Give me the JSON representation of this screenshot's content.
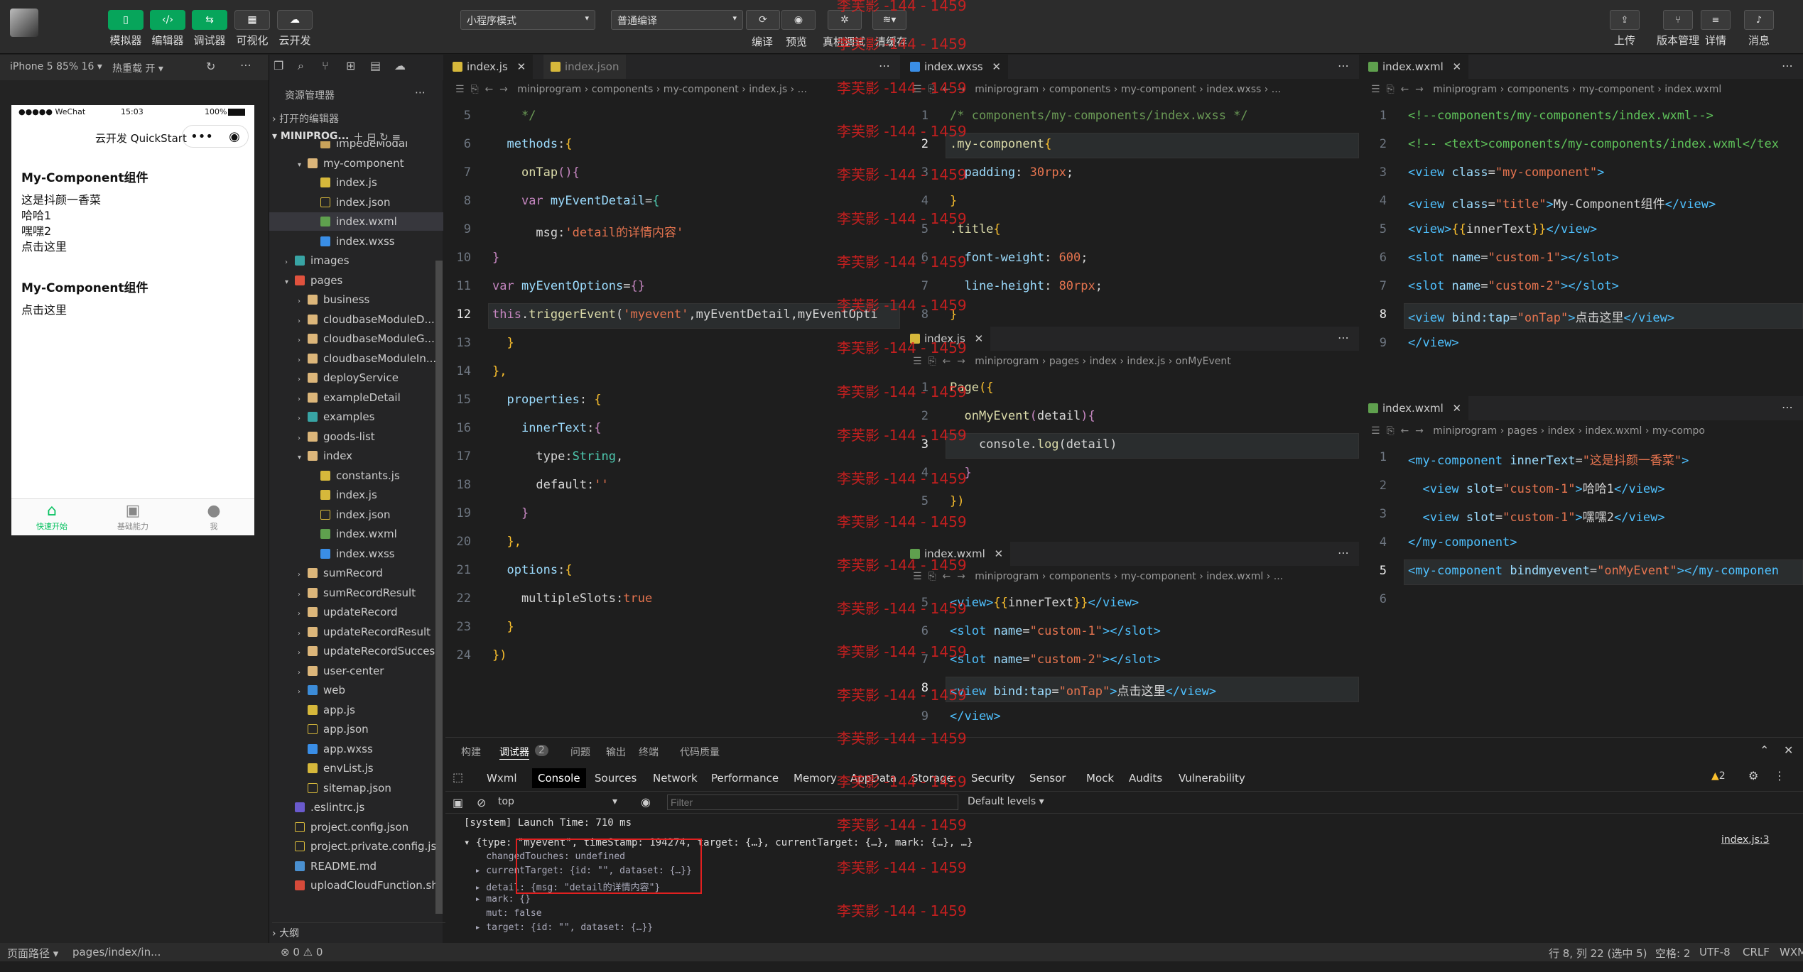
{
  "toolbar": {
    "buttons": [
      "模拟器",
      "编辑器",
      "调试器",
      "可视化",
      "云开发"
    ],
    "mode_select": "小程序模式",
    "compile_select": "普通编译",
    "center_labels": [
      "编译",
      "预览",
      "真机调试",
      "清缓存"
    ],
    "right_labels": [
      "上传",
      "版本管理",
      "详情",
      "消息"
    ]
  },
  "simulator": {
    "device": "iPhone 5 85% 16 ▾",
    "hot_reload": "热重载 开 ▾",
    "status_carrier": "●●●●● WeChat",
    "status_time": "15:03",
    "status_battery": "100%",
    "nav_title": "云开发 QuickStart",
    "content": [
      {
        "heading": "My-Component组件",
        "lines": [
          "这是抖颜一香菜",
          "哈哈1",
          "嘿嘿2",
          "点击这里"
        ]
      },
      {
        "heading": "My-Component组件",
        "lines": [
          "点击这里"
        ]
      }
    ],
    "tabbar": [
      {
        "label": "快速开始",
        "icon": "home-icon"
      },
      {
        "label": "基础能力",
        "icon": "terminal-icon"
      },
      {
        "label": "我",
        "icon": "user-icon"
      }
    ]
  },
  "explorer": {
    "title": "资源管理器",
    "open_editors": "打开的编辑器",
    "project": "MINIPROG...",
    "items": [
      {
        "name": "impedeModal",
        "type": "dir",
        "indent": 3
      },
      {
        "name": "my-component",
        "type": "folder",
        "indent": 2,
        "open": true
      },
      {
        "name": "index.js",
        "type": "js",
        "indent": 3
      },
      {
        "name": "index.json",
        "type": "json",
        "indent": 3
      },
      {
        "name": "index.wxml",
        "type": "wxml",
        "indent": 3,
        "selected": true
      },
      {
        "name": "index.wxss",
        "type": "wxss",
        "indent": 3
      },
      {
        "name": "images",
        "type": "fteal",
        "indent": 1,
        "closed": true
      },
      {
        "name": "pages",
        "type": "fred",
        "indent": 1,
        "open": true
      },
      {
        "name": "business",
        "type": "folder",
        "indent": 2,
        "closed": true
      },
      {
        "name": "cloudbaseModuleD...",
        "type": "folder",
        "indent": 2,
        "closed": true
      },
      {
        "name": "cloudbaseModuleG...",
        "type": "folder",
        "indent": 2,
        "closed": true
      },
      {
        "name": "cloudbaseModuleIn...",
        "type": "folder",
        "indent": 2,
        "closed": true
      },
      {
        "name": "deployService",
        "type": "folder",
        "indent": 2,
        "closed": true
      },
      {
        "name": "exampleDetail",
        "type": "folder",
        "indent": 2,
        "closed": true
      },
      {
        "name": "examples",
        "type": "fteal",
        "indent": 2,
        "closed": true
      },
      {
        "name": "goods-list",
        "type": "folder",
        "indent": 2,
        "closed": true
      },
      {
        "name": "index",
        "type": "folder",
        "indent": 2,
        "open": true
      },
      {
        "name": "constants.js",
        "type": "js",
        "indent": 3
      },
      {
        "name": "index.js",
        "type": "js",
        "indent": 3
      },
      {
        "name": "index.json",
        "type": "json",
        "indent": 3
      },
      {
        "name": "index.wxml",
        "type": "wxml",
        "indent": 3
      },
      {
        "name": "index.wxss",
        "type": "wxss",
        "indent": 3
      },
      {
        "name": "sumRecord",
        "type": "folder",
        "indent": 2,
        "closed": true
      },
      {
        "name": "sumRecordResult",
        "type": "folder",
        "indent": 2,
        "closed": true
      },
      {
        "name": "updateRecord",
        "type": "folder",
        "indent": 2,
        "closed": true
      },
      {
        "name": "updateRecordResult",
        "type": "folder",
        "indent": 2,
        "closed": true
      },
      {
        "name": "updateRecordSuccess",
        "type": "folder",
        "indent": 2,
        "closed": true
      },
      {
        "name": "user-center",
        "type": "folder",
        "indent": 2,
        "closed": true
      },
      {
        "name": "web",
        "type": "fblue",
        "indent": 2,
        "closed": true
      },
      {
        "name": "app.js",
        "type": "js",
        "indent": 2
      },
      {
        "name": "app.json",
        "type": "json",
        "indent": 2
      },
      {
        "name": "app.wxss",
        "type": "wxss",
        "indent": 2
      },
      {
        "name": "envList.js",
        "type": "js",
        "indent": 2
      },
      {
        "name": "sitemap.json",
        "type": "json",
        "indent": 2
      },
      {
        "name": ".eslintrc.js",
        "type": "esl",
        "indent": 1
      },
      {
        "name": "project.config.json",
        "type": "json",
        "indent": 1
      },
      {
        "name": "project.private.config.js...",
        "type": "json",
        "indent": 1
      },
      {
        "name": "README.md",
        "type": "md",
        "indent": 1
      },
      {
        "name": "uploadCloudFunction.sh",
        "type": "sh",
        "indent": 1
      }
    ],
    "outline": "大纲"
  },
  "editor1": {
    "tabs": [
      "index.js",
      "index.json"
    ],
    "crumb": "miniprogram  ›  components  ›  my-component  ›  index.js  ›  ...",
    "lines": [
      {
        "n": "5",
        "html": "    <span class='c'>*/</span>"
      },
      {
        "n": "6",
        "html": "  <span class='v'>methods</span>:<span class='p'>{</span>"
      },
      {
        "n": "7",
        "html": "    <span class='f'>onTap</span><span class='k'>(){</span>"
      },
      {
        "n": "8",
        "html": "    <span class='k'>var</span> <span class='v'>myEventDetail</span>=<span class='t'>{</span>"
      },
      {
        "n": "9",
        "html": "      msg:<span class='s'>'detail的详情内容'</span>"
      },
      {
        "n": "10",
        "html": "<span class='k'>}</span>"
      },
      {
        "n": "11",
        "html": "<span class='k'>var</span> <span class='v'>myEventOptions</span>=<span class='k'>{}</span>"
      },
      {
        "n": "12",
        "html": "<span class='k'>this</span>.<span class='f'>triggerEvent</span>(<span class='s'>'myevent'</span>,myEventDetail,myEventOpti",
        "cur": true
      },
      {
        "n": "13",
        "html": "  <span class='p'>}</span>"
      },
      {
        "n": "14",
        "html": "<span class='p'>},</span>"
      },
      {
        "n": "15",
        "html": "  <span class='v'>properties</span>: <span class='p'>{</span>"
      },
      {
        "n": "16",
        "html": "    <span class='v'>innerText</span>:<span class='k'>{</span>"
      },
      {
        "n": "17",
        "html": "      type:<span class='t'>String</span>,"
      },
      {
        "n": "18",
        "html": "      default:<span class='s'>''</span>"
      },
      {
        "n": "19",
        "html": "    <span class='k'>}</span>"
      },
      {
        "n": "20",
        "html": "  <span class='p'>},</span>"
      },
      {
        "n": "21",
        "html": "  <span class='v'>options</span>:<span class='p'>{</span>"
      },
      {
        "n": "22",
        "html": "    multipleSlots:<span class='n'>true</span>"
      },
      {
        "n": "23",
        "html": "  <span class='p'>}</span>"
      },
      {
        "n": "24",
        "html": "<span class='p'>})</span>"
      }
    ]
  },
  "editor2": {
    "tab": "index.wxss",
    "crumb": "miniprogram  ›  components  ›  my-component  ›  index.wxss  ›  ...",
    "lines": [
      {
        "n": "1",
        "html": "<span class='c'>/* components/my-components/index.wxss */</span>"
      },
      {
        "n": "2",
        "html": "<span class='f'>.my-component</span><span class='p'>{</span>",
        "cur": true
      },
      {
        "n": "3",
        "html": "  <span class='v'>padding</span>: <span class='n'>30</span><span class='s'>rpx</span>;"
      },
      {
        "n": "4",
        "html": "<span class='p'>}</span>"
      },
      {
        "n": "5",
        "html": "<span class='f'>.title</span><span class='p'>{</span>"
      },
      {
        "n": "6",
        "html": "  <span class='v'>font-weight</span>: <span class='n'>600</span>;"
      },
      {
        "n": "7",
        "html": "  <span class='v'>line-height</span>: <span class='n'>80</span><span class='s'>rpx</span>;"
      },
      {
        "n": "8",
        "html": "<span class='p'>}</span>"
      }
    ]
  },
  "editor3": {
    "tab": "index.js",
    "crumb": "miniprogram  ›  pages  ›  index  ›  index.js  ›  onMyEvent",
    "lines": [
      {
        "n": "1",
        "html": "<span class='f'>Page</span><span class='p'>({</span>"
      },
      {
        "n": "2",
        "html": "  <span class='f'>onMyEvent</span><span class='k'>(</span>detail<span class='k'>){</span>"
      },
      {
        "n": "3",
        "html": "    console.<span class='f'>log</span>(detail)",
        "cur": true
      },
      {
        "n": "4",
        "html": "  <span class='k'>}</span>"
      },
      {
        "n": "5",
        "html": "<span class='p'>})</span>"
      }
    ]
  },
  "editor4": {
    "tab": "index.wxml",
    "crumb": "miniprogram  ›  components  ›  my-component  ›  index.wxml  ›  ...",
    "lines": [
      {
        "n": "5",
        "html": "<span class='tg'>&lt;view&gt;</span><span class='p'>{{</span>innerText<span class='p'>}}</span><span class='tg'>&lt;/view&gt;</span>"
      },
      {
        "n": "6",
        "html": "<span class='tg'>&lt;slot</span> <span class='a'>name</span>=<span class='s'>\"custom-1\"</span><span class='tg'>&gt;&lt;/slot&gt;</span>"
      },
      {
        "n": "7",
        "html": "<span class='tg'>&lt;slot</span> <span class='a'>name</span>=<span class='s'>\"custom-2\"</span><span class='tg'>&gt;&lt;/slot&gt;</span>"
      },
      {
        "n": "8",
        "html": "<span class='tg'>&lt;view</span> <span class='a'>bind:tap</span>=<span class='s'>\"onTap\"</span><span class='tg'>&gt;</span>点击这里<span class='tg'>&lt;/view&gt;</span>",
        "cur": true
      },
      {
        "n": "9",
        "html": "<span class='tg'>&lt;/view&gt;</span>"
      }
    ]
  },
  "editor5": {
    "tab": "index.wxml",
    "crumb": "miniprogram  ›  components  ›  my-component  ›  index.wxml",
    "lines": [
      {
        "n": "1",
        "html": "<span class='g'>&lt;!--components/my-components/index.wxml--&gt;</span>"
      },
      {
        "n": "2",
        "html": "<span class='g'>&lt;!-- &lt;text&gt;components/my-components/index.wxml&lt;/tex</span>"
      },
      {
        "n": "3",
        "html": "<span class='tg'>&lt;view</span> <span class='a'>class</span>=<span class='s'>\"my-component\"</span><span class='tg'>&gt;</span>"
      },
      {
        "n": "4",
        "html": "<span class='tg'>&lt;view</span> <span class='a'>class</span>=<span class='s'>\"title\"</span><span class='tg'>&gt;</span>My-Component组件<span class='tg'>&lt;/view&gt;</span>"
      },
      {
        "n": "5",
        "html": "<span class='tg'>&lt;view&gt;</span><span class='p'>{{</span>innerText<span class='p'>}}</span><span class='tg'>&lt;/view&gt;</span>"
      },
      {
        "n": "6",
        "html": "<span class='tg'>&lt;slot</span> <span class='a'>name</span>=<span class='s'>\"custom-1\"</span><span class='tg'>&gt;&lt;/slot&gt;</span>"
      },
      {
        "n": "7",
        "html": "<span class='tg'>&lt;slot</span> <span class='a'>name</span>=<span class='s'>\"custom-2\"</span><span class='tg'>&gt;&lt;/slot&gt;</span>"
      },
      {
        "n": "8",
        "html": "<span class='tg'>&lt;view</span> <span class='a'>bind:tap</span>=<span class='s'>\"onTap\"</span><span class='tg'>&gt;</span>点击这里<span class='tg'>&lt;/view&gt;</span>",
        "cur": true
      },
      {
        "n": "9",
        "html": "<span class='tg'>&lt;/view&gt;</span>"
      }
    ]
  },
  "editor6": {
    "tab": "index.wxml",
    "crumb": "miniprogram  ›  pages  ›  index  ›  index.wxml  ›  my-compo",
    "lines": [
      {
        "n": "1",
        "html": "<span class='tg'>&lt;my-component</span> <span class='a'>innerText</span>=<span class='s'>\"这是抖颜一香菜\"</span><span class='tg'>&gt;</span>"
      },
      {
        "n": "2",
        "html": "  <span class='tg'>&lt;view</span> <span class='a'>slot</span>=<span class='s'>\"custom-1\"</span><span class='tg'>&gt;</span>哈哈1<span class='tg'>&lt;/view&gt;</span>"
      },
      {
        "n": "3",
        "html": "  <span class='tg'>&lt;view</span> <span class='a'>slot</span>=<span class='s'>\"custom-1\"</span><span class='tg'>&gt;</span>嘿嘿2<span class='tg'>&lt;/view&gt;</span>"
      },
      {
        "n": "4",
        "html": "<span class='tg'>&lt;/my-component&gt;</span>"
      },
      {
        "n": "5",
        "html": "<span class='tg'>&lt;my-component</span> <span class='a'>bindmyevent</span>=<span class='s'>\"onMyEvent\"</span><span class='tg'>&gt;&lt;/my-componen</span>",
        "cur": true
      },
      {
        "n": "6",
        "html": ""
      }
    ]
  },
  "console": {
    "panel_tabs": [
      "构建",
      "调试器",
      "问题",
      "输出",
      "终端",
      "代码质量"
    ],
    "badge": "2",
    "devtabs": [
      "Wxml",
      "Console",
      "Sources",
      "Network",
      "Performance",
      "Memory",
      "AppData",
      "Storage",
      "Security",
      "Sensor",
      "Mock",
      "Audits",
      "Vulnerability"
    ],
    "context": "top",
    "filter_placeholder": "Filter",
    "levels": "Default levels ▾",
    "warn_count": "2",
    "lines": [
      "[system] Launch Time: 710 ms",
      "▾ {type: \"myevent\", timeStamp: 194274, target: {…}, currentTarget: {…}, mark: {…}, …}",
      "    changedTouches: undefined",
      "  ▸ currentTarget: {id: \"\", dataset: {…}}",
      "  ▸ detail: {msg: \"detail的详情内容\"}",
      "  ▸ mark: {}",
      "    mut: false",
      "  ▸ target: {id: \"\", dataset: {…}}"
    ],
    "source_link": "index.js:3"
  },
  "watermark": "李芙影 -144 - 1459",
  "status": {
    "left": [
      "页面路径 ▾",
      "pages/index/in..."
    ],
    "errors": "⊗ 0 ⚠ 0",
    "right": [
      "行 8, 列 22 (选中 5)",
      "空格: 2",
      "UTF-8",
      "CRLF",
      "WXM"
    ]
  },
  "colors": {
    "accent": "#07c160",
    "bg": "#1e1e1e"
  }
}
